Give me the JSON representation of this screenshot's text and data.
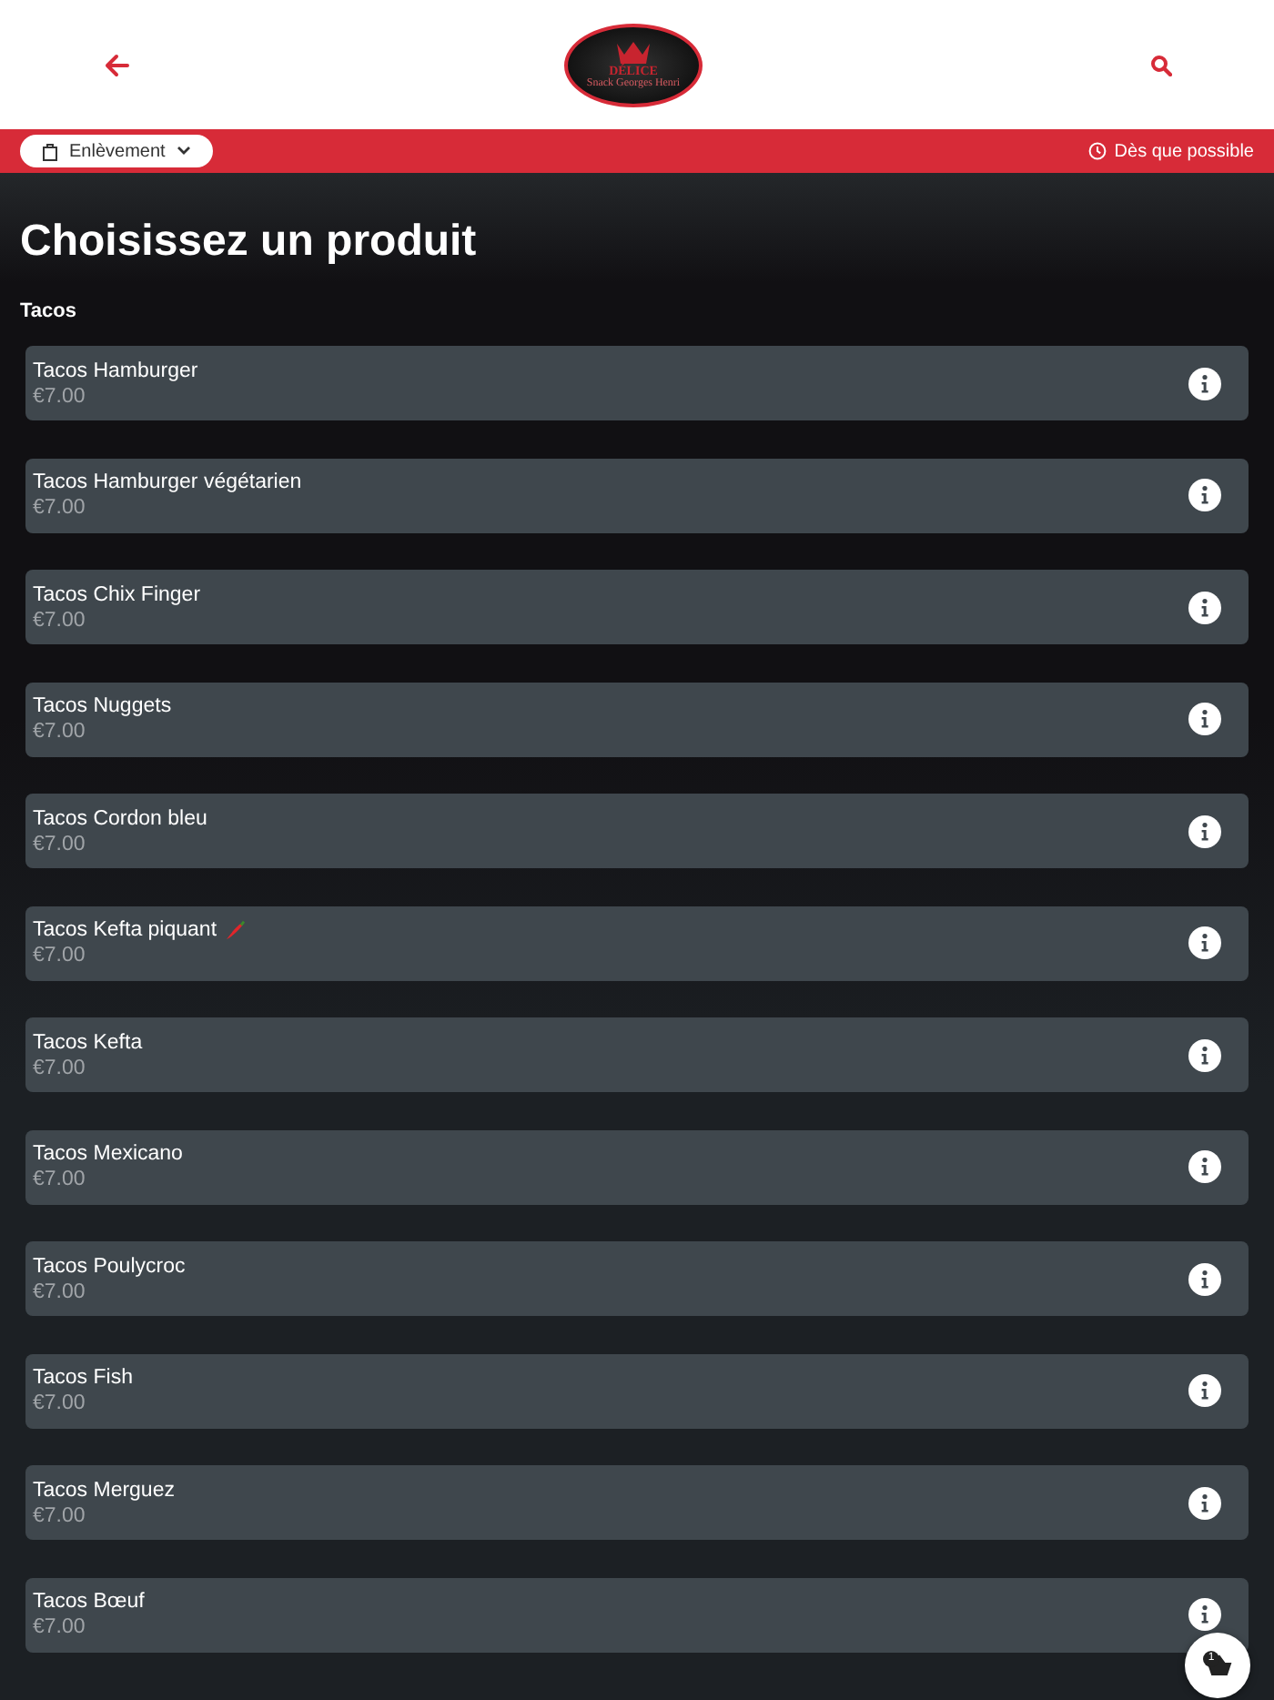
{
  "header": {
    "logo": {
      "title": "DÉLICE",
      "subtitle": "Snack Georges Henri"
    }
  },
  "order_bar": {
    "mode": "Enlèvement",
    "time": "Dès que possible"
  },
  "page_title": "Choisissez un produit",
  "category": "Tacos",
  "products": [
    {
      "name": "Tacos Hamburger",
      "price": "€7.00",
      "spicy": false
    },
    {
      "name": "Tacos Hamburger végétarien",
      "price": "€7.00",
      "spicy": false
    },
    {
      "name": "Tacos Chix Finger",
      "price": "€7.00",
      "spicy": false
    },
    {
      "name": "Tacos Nuggets",
      "price": "€7.00",
      "spicy": false
    },
    {
      "name": "Tacos Cordon bleu",
      "price": "€7.00",
      "spicy": false
    },
    {
      "name": "Tacos Kefta piquant",
      "price": "€7.00",
      "spicy": true
    },
    {
      "name": "Tacos Kefta",
      "price": "€7.00",
      "spicy": false
    },
    {
      "name": "Tacos Mexicano",
      "price": "€7.00",
      "spicy": false
    },
    {
      "name": "Tacos Poulycroc",
      "price": "€7.00",
      "spicy": false
    },
    {
      "name": "Tacos Fish",
      "price": "€7.00",
      "spicy": false
    },
    {
      "name": "Tacos Merguez",
      "price": "€7.00",
      "spicy": false
    },
    {
      "name": "Tacos Bœuf",
      "price": "€7.00",
      "spicy": false
    }
  ],
  "cart": {
    "count": "1"
  }
}
